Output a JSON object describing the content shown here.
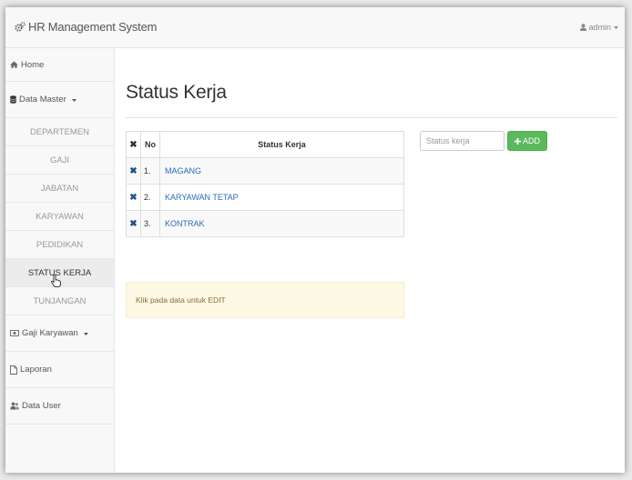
{
  "app": {
    "brand": "HR Management System",
    "user": "admin"
  },
  "sidebar": {
    "home": "Home",
    "data_master": "Data Master",
    "submenu": [
      "DEPARTEMEN",
      "GAJI",
      "JABATAN",
      "KARYAWAN",
      "PEDIDIKAN",
      "STATUS KERJA",
      "TUNJANGAN"
    ],
    "active_submenu": "STATUS KERJA",
    "gaji_karyawan": "Gaji Karyawan",
    "laporan": "Laporan",
    "data_user": "Data User"
  },
  "main": {
    "title": "Status Kerja",
    "table": {
      "headers": {
        "no": "No",
        "status": "Status Kerja"
      },
      "rows": [
        {
          "no": "1.",
          "status": "MAGANG"
        },
        {
          "no": "2.",
          "status": "KARYAWAN TETAP"
        },
        {
          "no": "3.",
          "status": "KONTRAK"
        }
      ]
    },
    "add": {
      "placeholder": "Status kerja",
      "button": "ADD"
    },
    "alert": "Klik pada data untuk EDIT"
  },
  "colors": {
    "accent": "#5cb85c",
    "link": "#2a6bb6",
    "alert_bg": "#fcf8e3"
  },
  "icons": [
    "cogs-icon",
    "user-icon",
    "caret-down-icon",
    "home-icon",
    "database-icon",
    "money-icon",
    "file-icon",
    "users-icon",
    "remove-icon",
    "plus-icon",
    "hand-cursor-icon"
  ]
}
